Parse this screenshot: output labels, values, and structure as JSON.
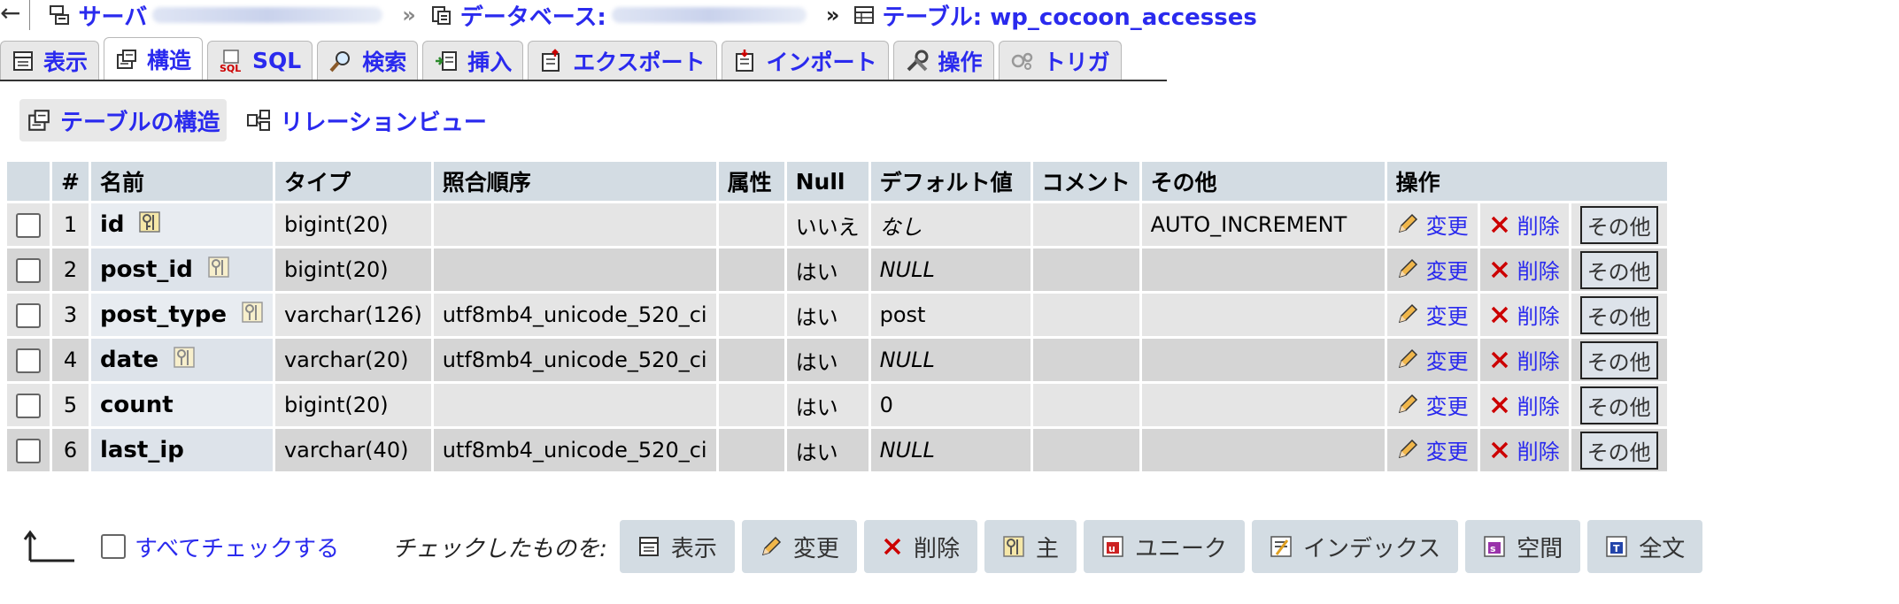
{
  "breadcrumb": {
    "back": "←",
    "server_label": "サーバ",
    "database_label": "データベース:",
    "sep_chevron": "»",
    "table_label": "テーブル: wp_cocoon_accesses"
  },
  "tabs": [
    {
      "label": "表示",
      "icon": "browse-icon"
    },
    {
      "label": "構造",
      "icon": "structure-icon",
      "active": true
    },
    {
      "label": "SQL",
      "icon": "sql-icon"
    },
    {
      "label": "検索",
      "icon": "search-icon"
    },
    {
      "label": "挿入",
      "icon": "insert-icon"
    },
    {
      "label": "エクスポート",
      "icon": "export-icon"
    },
    {
      "label": "インポート",
      "icon": "import-icon"
    },
    {
      "label": "操作",
      "icon": "operations-icon"
    },
    {
      "label": "トリガ",
      "icon": "triggers-icon"
    }
  ],
  "subnav": {
    "structure_label": "テーブルの構造",
    "relation_label": "リレーションビュー"
  },
  "table": {
    "headers": [
      "#",
      "名前",
      "タイプ",
      "照合順序",
      "属性",
      "Null",
      "デフォルト値",
      "コメント",
      "その他",
      "操作"
    ],
    "rows": [
      {
        "num": "1",
        "name": "id",
        "type": "bigint(20)",
        "collation": "",
        "attributes": "",
        "null": "いいえ",
        "default": "なし",
        "comment": "",
        "extra": "AUTO_INCREMENT"
      },
      {
        "num": "2",
        "name": "post_id",
        "type": "bigint(20)",
        "collation": "",
        "attributes": "",
        "null": "はい",
        "default": "NULL",
        "comment": "",
        "extra": ""
      },
      {
        "num": "3",
        "name": "post_type",
        "type": "varchar(126)",
        "collation": "utf8mb4_unicode_520_ci",
        "attributes": "",
        "null": "はい",
        "default": "post",
        "comment": "",
        "extra": ""
      },
      {
        "num": "4",
        "name": "date",
        "type": "varchar(20)",
        "collation": "utf8mb4_unicode_520_ci",
        "attributes": "",
        "null": "はい",
        "default": "NULL",
        "comment": "",
        "extra": ""
      },
      {
        "num": "5",
        "name": "count",
        "type": "bigint(20)",
        "collation": "",
        "attributes": "",
        "null": "はい",
        "default": "0",
        "comment": "",
        "extra": ""
      },
      {
        "num": "6",
        "name": "last_ip",
        "type": "varchar(40)",
        "collation": "utf8mb4_unicode_520_ci",
        "attributes": "",
        "null": "はい",
        "default": "NULL",
        "comment": "",
        "extra": ""
      }
    ],
    "actions": {
      "change": "変更",
      "drop": "削除",
      "more": "その他"
    }
  },
  "footer": {
    "check_all": "すべてチェックする",
    "with_selected": "チェックしたものを:",
    "buttons": [
      {
        "label": "表示",
        "icon": "browse-icon"
      },
      {
        "label": "変更",
        "icon": "pencil-icon"
      },
      {
        "label": "削除",
        "icon": "drop-icon"
      },
      {
        "label": "主",
        "icon": "primary-key-icon"
      },
      {
        "label": "ユニーク",
        "icon": "unique-icon"
      },
      {
        "label": "インデックス",
        "icon": "index-icon"
      },
      {
        "label": "空間",
        "icon": "spatial-icon"
      },
      {
        "label": "全文",
        "icon": "fulltext-icon"
      }
    ]
  },
  "colors": {
    "link": "#2a2aee",
    "header_bg": "#d3dce3",
    "row_bg": "#e5e5e5",
    "row_alt_bg": "#d5d5d5",
    "drop_red": "#cc0000"
  }
}
